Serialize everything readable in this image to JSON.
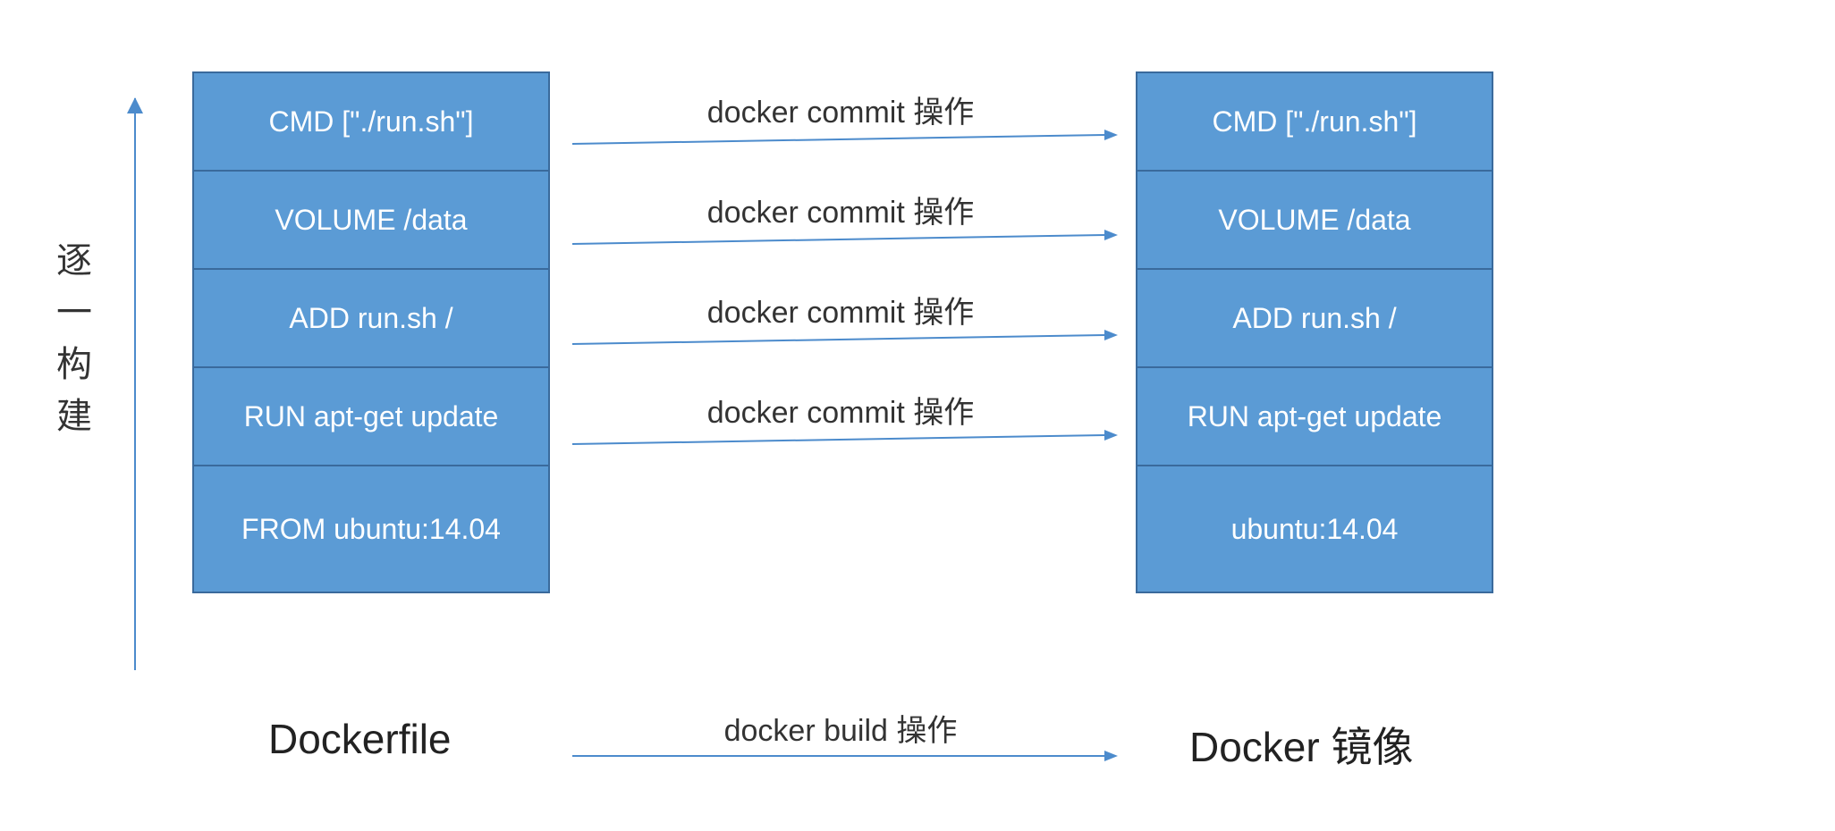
{
  "vertical_label": "逐一构建",
  "left_stack": {
    "title": "Dockerfile",
    "layers": [
      "CMD [\"./run.sh\"]",
      "VOLUME /data",
      "ADD run.sh  /",
      "RUN apt-get update",
      "FROM ubuntu:14.04"
    ]
  },
  "right_stack": {
    "title": "Docker 镜像",
    "layers": [
      "CMD [\"./run.sh\"]",
      "VOLUME /data",
      "ADD run.sh  /",
      "RUN apt-get update",
      "ubuntu:14.04"
    ]
  },
  "commit_labels": [
    "docker commit 操作",
    "docker commit 操作",
    "docker commit 操作",
    "docker commit 操作"
  ],
  "build_label": "docker build 操作",
  "colors": {
    "box_fill": "#5B9BD5",
    "box_border": "#3a6a9c",
    "arrow": "#4C8BCC"
  }
}
